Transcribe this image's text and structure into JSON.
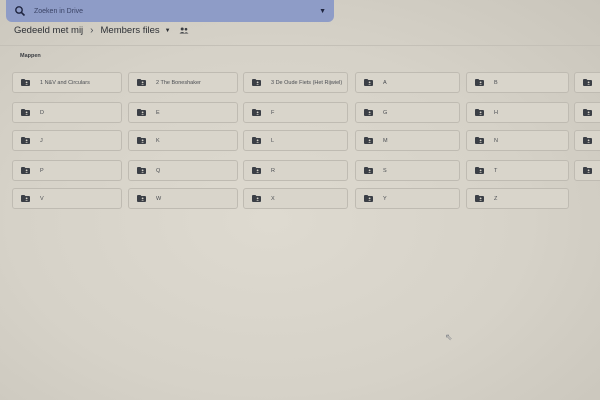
{
  "search": {
    "placeholder": "Zoeken in Drive"
  },
  "breadcrumb": {
    "parent": "Gedeeld met mij",
    "current": "Members files"
  },
  "section": {
    "title": "Mappen"
  },
  "folders": [
    [
      "1 N&V and Circulars",
      "2 The Boneshaker",
      "3 De Oude Fiets (Het Rijwiel)",
      "A",
      "B",
      ""
    ],
    [
      "D",
      "E",
      "F",
      "G",
      "H",
      ""
    ],
    [
      "J",
      "K",
      "L",
      "M",
      "N",
      ""
    ],
    [
      "P",
      "Q",
      "R",
      "S",
      "T",
      ""
    ],
    [
      "V",
      "W",
      "X",
      "Y",
      "Z"
    ]
  ],
  "colors": {
    "folder_icon": "#3b3f46",
    "search_bar": "#8e9cc7"
  }
}
